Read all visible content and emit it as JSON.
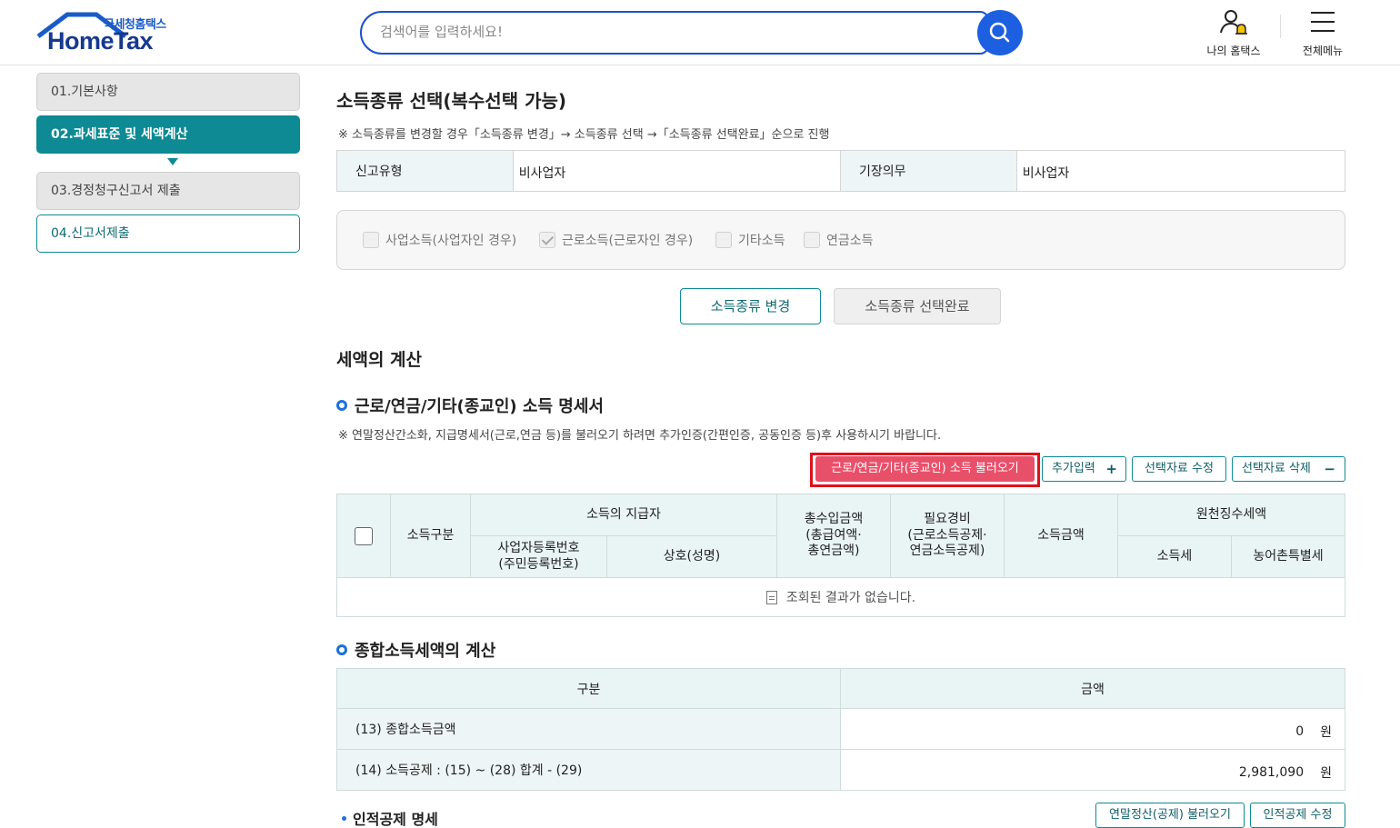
{
  "header": {
    "logo_sub": "국세청홈택스",
    "logo_main": "HomeTax",
    "search_placeholder": "검색어를 입력하세요!",
    "my_hometax": "나의 홈택스",
    "all_menu": "전체메뉴"
  },
  "sidebar": {
    "items": [
      {
        "label": "01.기본사항"
      },
      {
        "label": "02.과세표준 및 세액계산"
      },
      {
        "label": "03.경정청구신고서 제출"
      },
      {
        "label": "04.신고서제출"
      }
    ]
  },
  "income_type": {
    "title": "소득종류 선택(복수선택 가능)",
    "note": "※ 소득종류를 변경할 경우「소득종류 변경」→ 소득종류 선택 →「소득종류 선택완료」순으로 진행",
    "report_type_label": "신고유형",
    "report_type_value": "비사업자",
    "bookkeeping_label": "기장의무",
    "bookkeeping_value": "비사업자",
    "options": [
      {
        "label": "사업소득(사업자인 경우)",
        "checked": false
      },
      {
        "label": "근로소득(근로자인 경우)",
        "checked": true
      },
      {
        "label": "기타소득",
        "checked": false
      },
      {
        "label": "연금소득",
        "checked": false
      }
    ],
    "change_button": "소득종류 변경",
    "complete_button": "소득종류 선택완료"
  },
  "tax_calc": {
    "title": "세액의 계산",
    "income_stmt": {
      "title": "근로/연금/기타(종교인) 소득 명세서",
      "note": "※ 연말정산간소화, 지급명세서(근로,연금 등)를 불러오기 하려면 추가인증(간편인증, 공동인증 등)후 사용하시기 바랍니다.",
      "load_button": "근로/연금/기타(종교인) 소득 불러오기",
      "add_button": "추가입력",
      "edit_button": "선택자료 수정",
      "delete_button": "선택자료 삭제",
      "headers": {
        "income_type": "소득구분",
        "payer": "소득의 지급자",
        "biz_no": "사업자등록번호\n(주민등록번호)",
        "name": "상호(성명)",
        "gross": "총수입금액\n(총급여액·\n총연금액)",
        "expense": "필요경비\n(근로소득공제·\n연금소득공제)",
        "income": "소득금액",
        "withholding": "원천징수세액",
        "income_tax": "소득세",
        "rural_tax": "농어촌특별세"
      },
      "empty_message": "조회된 결과가 없습니다."
    },
    "global_tax": {
      "title": "종합소득세액의 계산",
      "col_category": "구분",
      "col_amount": "금액",
      "rows": [
        {
          "label": "(13) 종합소득금액",
          "value": "0",
          "unit": "원"
        },
        {
          "label": "(14) 소득공제 : (15) ~ (28) 합계 - (29)",
          "value": "2,981,090",
          "unit": "원"
        }
      ]
    },
    "personal_deduction": {
      "title": "인적공제 명세",
      "load_button": "연말정산(공제) 불러오기",
      "edit_button": "인적공제 수정"
    }
  }
}
